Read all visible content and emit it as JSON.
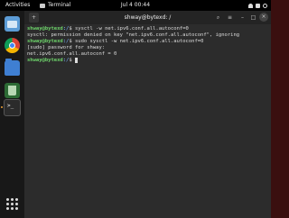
{
  "topbar": {
    "activities": "Activities",
    "app_name": "Terminal",
    "clock": "Jul 4  00:44"
  },
  "window": {
    "title": "shway@bytexd: /",
    "new_tab_glyph": "+",
    "search_glyph": "⌕",
    "menu_glyph": "≡",
    "minimize_glyph": "–",
    "maximize_glyph": "□",
    "close_glyph": "×"
  },
  "terminal": {
    "lines": [
      {
        "user": "shway@bytexd",
        "path": ":/",
        "cmd": "$ sysctl -w net.ipv6.conf.all.autoconf=0"
      },
      {
        "text": "sysctl: permission denied on key \"net.ipv6.conf.all.autoconf\", ignoring"
      },
      {
        "user": "shway@bytexd",
        "path": ":/",
        "cmd": "$ sudo sysctl -w net.ipv6.conf.all.autoconf=0"
      },
      {
        "text": "[sudo] password for shway:"
      },
      {
        "text": "net.ipv6.conf.all.autoconf = 0"
      },
      {
        "user": "shway@bytexd",
        "path": ":/",
        "cmd": "$ "
      }
    ]
  },
  "dock": {
    "icons": [
      "files-icon",
      "chrome-icon",
      "folder-icon",
      "trash-icon",
      "terminal-icon",
      "app-grid-icon"
    ]
  },
  "colors": {
    "prompt_user": "#6dd36a",
    "prompt_path": "#6f9fe0",
    "terminal_bg": "#2c2c2c",
    "topbar_bg": "#000000"
  }
}
